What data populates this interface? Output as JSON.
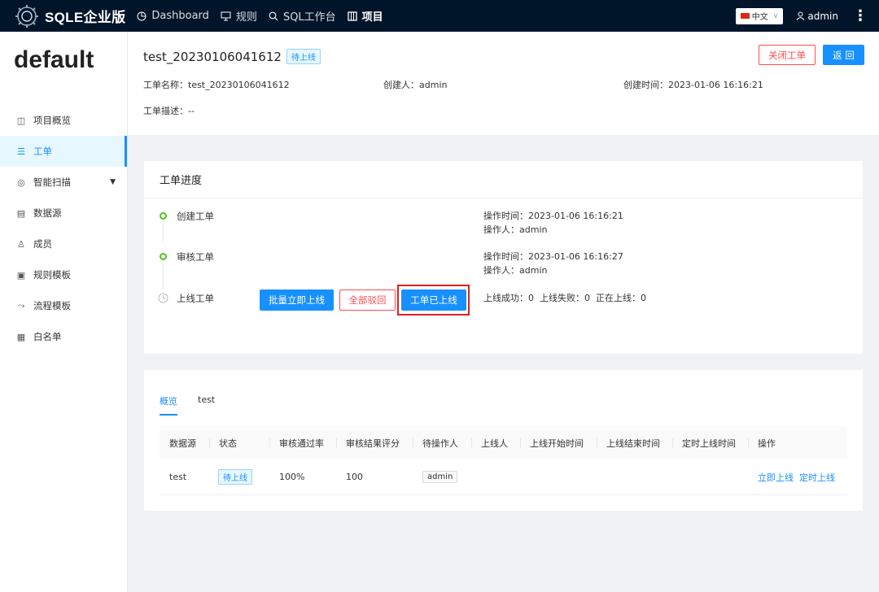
{
  "topbar": {
    "brand": "SQLE企业版",
    "nav": [
      {
        "label": "Dashboard",
        "icon": "pie-chart-icon"
      },
      {
        "label": "规则",
        "icon": "monitor-icon"
      },
      {
        "label": "SQL工作台",
        "icon": "search-icon"
      },
      {
        "label": "项目",
        "icon": "project-icon"
      }
    ],
    "language": "中文",
    "user": "admin"
  },
  "sidebar": {
    "project": "default",
    "items": [
      {
        "label": "项目概览",
        "icon": "overview-icon"
      },
      {
        "label": "工单",
        "icon": "list-icon"
      },
      {
        "label": "智能扫描",
        "icon": "scan-icon"
      },
      {
        "label": "数据源",
        "icon": "database-icon"
      },
      {
        "label": "成员",
        "icon": "user-icon"
      },
      {
        "label": "规则模板",
        "icon": "rule-template-icon"
      },
      {
        "label": "流程模板",
        "icon": "flow-icon"
      },
      {
        "label": "白名单",
        "icon": "whitelist-icon"
      }
    ]
  },
  "header": {
    "title": "test_20230106041612",
    "status": "待上线",
    "close_label": "关闭工单",
    "back_label": "返 回",
    "name_text": "工单名称：test_20230106041612",
    "creator_text": "创建人：admin",
    "created_text": "创建时间：2023-01-06 16:16:21",
    "desc_text": "工单描述：--"
  },
  "progress": {
    "title": "工单进度",
    "steps": [
      {
        "label": "创建工单",
        "time": "操作时间：2023-01-06 16:16:21",
        "operator": "操作人：admin"
      },
      {
        "label": "审核工单",
        "time": "操作时间：2023-01-06 16:16:27",
        "operator": "操作人：admin"
      },
      {
        "label": "上线工单",
        "stats": "上线成功：0  上线失败：0  正在上线：0"
      }
    ],
    "batch_label": "批量立即上线",
    "reject_label": "全部驳回",
    "done_label": "工单已上线"
  },
  "overview": {
    "tabs": [
      "概览",
      "test"
    ],
    "columns": [
      "数据源",
      "状态",
      "审核通过率",
      "审核结果评分",
      "待操作人",
      "上线人",
      "上线开始时间",
      "上线结束时间",
      "定时上线时间",
      "操作"
    ],
    "rows": [
      {
        "datasource": "test",
        "status": "待上线",
        "pass_rate": "100%",
        "score": "100",
        "operator": "admin",
        "launch_now": "立即上线",
        "launch_timed": "定时上线"
      }
    ]
  }
}
